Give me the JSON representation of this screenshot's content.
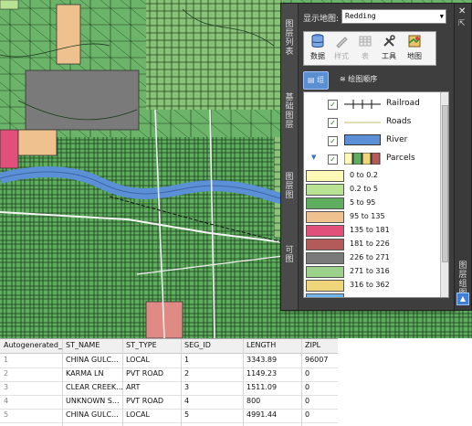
{
  "panel": {
    "display_map_label": "显示地图:",
    "display_map_value": "Redding",
    "left_strip_labels": [
      "图层列表",
      "基础图层",
      "图层图",
      "可图"
    ],
    "toolbar": {
      "data": "数据",
      "style": "样式",
      "table": "表",
      "tools": "工具",
      "map": "地图"
    },
    "tabs": {
      "layers": "组",
      "draw_order": "绘图顺序"
    },
    "layers": [
      {
        "name": "Railroad",
        "checked": true
      },
      {
        "name": "Roads",
        "checked": true
      },
      {
        "name": "River",
        "checked": false
      },
      {
        "name": "Parcels",
        "checked": true
      }
    ],
    "classes": [
      {
        "label": "0 to 0.2",
        "color": "#fff9b8"
      },
      {
        "label": "0.2 to 5",
        "color": "#b9e394"
      },
      {
        "label": "5 to 95",
        "color": "#5fae5f"
      },
      {
        "label": "95 to 135",
        "color": "#eec18e"
      },
      {
        "label": "135 to 181",
        "color": "#e0507a"
      },
      {
        "label": "181 to 226",
        "color": "#b35a5a"
      },
      {
        "label": "226 to 271",
        "color": "#7a7a7a"
      },
      {
        "label": "271 to 316",
        "color": "#9bd18a"
      },
      {
        "label": "316 to 362",
        "color": "#f0d67a"
      },
      {
        "label": "",
        "color": "#6fb9f0"
      }
    ],
    "right_strip_label": "图层组图"
  },
  "table": {
    "columns": [
      "Autogenerated_",
      "ST_NAME",
      "ST_TYPE",
      "SEG_ID",
      "LENGTH",
      "ZIPL"
    ],
    "rows": [
      [
        "1",
        "CHINA GULC...",
        "LOCAL",
        "1",
        "3343.89",
        "96007"
      ],
      [
        "2",
        "KARMA LN",
        "PVT ROAD",
        "2",
        "1149.23",
        "0"
      ],
      [
        "3",
        "CLEAR CREEK...",
        "ART",
        "3",
        "1511.09",
        "0"
      ],
      [
        "4",
        "UNKNOWN S...",
        "PVT ROAD",
        "4",
        "800",
        "0"
      ],
      [
        "5",
        "CHINA GULC...",
        "LOCAL",
        "5",
        "4991.44",
        "0"
      ]
    ]
  },
  "colors": {
    "parcel_green": "#5fae5f",
    "river": "#5b8fd6",
    "panel_bg": "#3e3e3e"
  }
}
